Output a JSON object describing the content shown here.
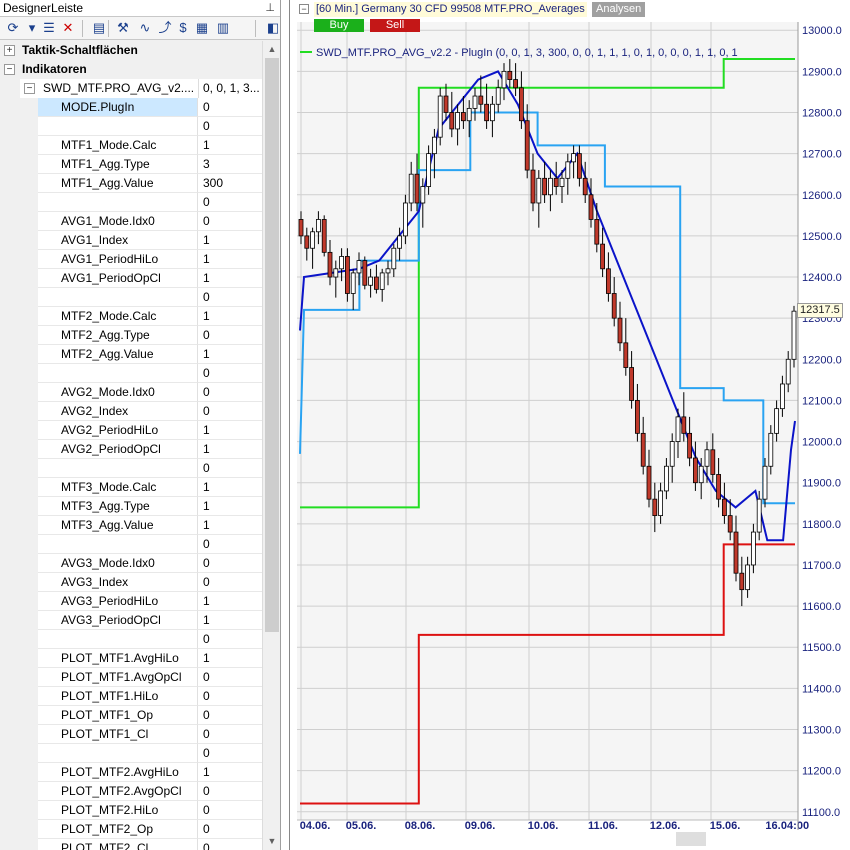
{
  "designer": {
    "title": "DesignerLeiste",
    "pin_glyph": "⊥",
    "toolbar": [
      {
        "icon": "refresh-icon",
        "glyph": "⟳"
      },
      {
        "icon": "dropdown-arrow-icon",
        "glyph": "▾"
      },
      {
        "icon": "list-icon",
        "glyph": "☰"
      },
      {
        "icon": "delete-icon",
        "glyph": "✕"
      },
      {
        "icon": "properties-icon",
        "glyph": "▤"
      },
      {
        "icon": "tools-icon",
        "glyph": "⚒"
      },
      {
        "icon": "indicator-icon",
        "glyph": "∿"
      },
      {
        "icon": "trend-line-icon",
        "glyph": "⤴"
      },
      {
        "icon": "dollar-icon",
        "glyph": "$"
      },
      {
        "icon": "grid-icon",
        "glyph": "▦"
      },
      {
        "icon": "chart-grid-icon",
        "glyph": "▥"
      },
      {
        "icon": "export-icon",
        "glyph": "◧"
      }
    ],
    "categories": [
      {
        "label": "Taktik-Schaltflächen",
        "expander": "+"
      },
      {
        "label": "Indikatoren",
        "expander": "−"
      }
    ],
    "indicator": {
      "name": "SWD_MTF.PRO_AVG_v2....",
      "value": "0, 0, 1, 3...",
      "expander": "−"
    },
    "properties": [
      {
        "name": "MODE.PlugIn",
        "value": "0"
      },
      {
        "name": "",
        "value": "0"
      },
      {
        "name": "MTF1_Mode.Calc",
        "value": "1"
      },
      {
        "name": "MTF1_Agg.Type",
        "value": "3"
      },
      {
        "name": "MTF1_Agg.Value",
        "value": "300"
      },
      {
        "name": "",
        "value": "0"
      },
      {
        "name": "AVG1_Mode.Idx0",
        "value": "0"
      },
      {
        "name": "AVG1_Index",
        "value": "1"
      },
      {
        "name": "AVG1_PeriodHiLo",
        "value": "1"
      },
      {
        "name": "AVG1_PeriodOpCl",
        "value": "1"
      },
      {
        "name": "",
        "value": "0"
      },
      {
        "name": "MTF2_Mode.Calc",
        "value": "1"
      },
      {
        "name": "MTF2_Agg.Type",
        "value": "0"
      },
      {
        "name": "MTF2_Agg.Value",
        "value": "1"
      },
      {
        "name": "",
        "value": "0"
      },
      {
        "name": "AVG2_Mode.Idx0",
        "value": "0"
      },
      {
        "name": "AVG2_Index",
        "value": "0"
      },
      {
        "name": "AVG2_PeriodHiLo",
        "value": "1"
      },
      {
        "name": "AVG2_PeriodOpCl",
        "value": "1"
      },
      {
        "name": "",
        "value": "0"
      },
      {
        "name": "MTF3_Mode.Calc",
        "value": "1"
      },
      {
        "name": "MTF3_Agg.Type",
        "value": "1"
      },
      {
        "name": "MTF3_Agg.Value",
        "value": "1"
      },
      {
        "name": "",
        "value": "0"
      },
      {
        "name": "AVG3_Mode.Idx0",
        "value": "0"
      },
      {
        "name": "AVG3_Index",
        "value": "0"
      },
      {
        "name": "AVG3_PeriodHiLo",
        "value": "1"
      },
      {
        "name": "AVG3_PeriodOpCl",
        "value": "1"
      },
      {
        "name": "",
        "value": "0"
      },
      {
        "name": "PLOT_MTF1.AvgHiLo",
        "value": "1"
      },
      {
        "name": "PLOT_MTF1.AvgOpCl",
        "value": "0"
      },
      {
        "name": "PLOT_MTF1.HiLo",
        "value": "0"
      },
      {
        "name": "PLOT_MTF1_Op",
        "value": "0"
      },
      {
        "name": "PLOT_MTF1_Cl",
        "value": "0"
      },
      {
        "name": "",
        "value": "0"
      },
      {
        "name": "PLOT_MTF2.AvgHiLo",
        "value": "1"
      },
      {
        "name": "PLOT_MTF2.AvgOpCl",
        "value": "0"
      },
      {
        "name": "PLOT_MTF2.HiLo",
        "value": "0"
      },
      {
        "name": "PLOT_MTF2_Op",
        "value": "0"
      },
      {
        "name": "PLOT_MTF2_Cl",
        "value": "0"
      }
    ],
    "selected_index": 0
  },
  "chart_header": {
    "collapse_glyph": "−",
    "title": "[60 Min.] Germany 30 CFD   99508 MTF.PRO_Averages",
    "analysen_tab": "Analysen",
    "buy_label": "Buy",
    "sell_label": "Sell",
    "legend_text": "SWD_MTF.PRO_AVG_v2.2 - PlugIn  (0, 0, 1, 3, 300, 0, 0, 1, 1, 1, 0, 1, 0, 0, 0, 1, 1, 0, 1",
    "current_price": "12317.5"
  },
  "colors": {
    "candle_up": "#ffffff",
    "candle_down": "#c0392b",
    "wick": "#000000",
    "mtf1_line": "#22dd22",
    "mtf2_line": "#29a3f2",
    "mtf3_line": "#0b14c9",
    "red_line": "#dd1111",
    "axis_text": "#1a237e",
    "grid": "#cfcfcf"
  },
  "chart_data": {
    "type": "line",
    "yticks": [
      13000,
      12900,
      12800,
      12700,
      12600,
      12500,
      12400,
      12300,
      12200,
      12100,
      12000,
      11900,
      11800,
      11700,
      11600,
      11500,
      11400,
      11300,
      11200,
      11100
    ],
    "xticks": [
      "04.06.",
      "05.06.",
      "08.06.",
      "09.06.",
      "10.06.",
      "11.06.",
      "12.06.",
      "15.06.",
      "16.",
      "04:00"
    ],
    "ylim": [
      11080,
      13020
    ],
    "candles": [
      [
        0,
        12540,
        12560,
        12480,
        12500
      ],
      [
        1,
        12500,
        12520,
        12440,
        12470
      ],
      [
        2,
        12470,
        12520,
        12420,
        12510
      ],
      [
        3,
        12510,
        12560,
        12480,
        12540
      ],
      [
        4,
        12540,
        12550,
        12450,
        12460
      ],
      [
        5,
        12460,
        12490,
        12380,
        12400
      ],
      [
        6,
        12400,
        12440,
        12350,
        12420
      ],
      [
        7,
        12420,
        12470,
        12390,
        12450
      ],
      [
        8,
        12450,
        12470,
        12340,
        12360
      ],
      [
        9,
        12360,
        12420,
        12320,
        12410
      ],
      [
        10,
        12410,
        12460,
        12380,
        12440
      ],
      [
        11,
        12440,
        12450,
        12370,
        12380
      ],
      [
        12,
        12380,
        12420,
        12350,
        12400
      ],
      [
        13,
        12400,
        12430,
        12360,
        12370
      ],
      [
        14,
        12370,
        12420,
        12340,
        12410
      ],
      [
        15,
        12410,
        12440,
        12380,
        12420
      ],
      [
        16,
        12420,
        12480,
        12400,
        12470
      ],
      [
        17,
        12470,
        12520,
        12440,
        12500
      ],
      [
        18,
        12500,
        12600,
        12480,
        12580
      ],
      [
        19,
        12580,
        12680,
        12560,
        12650
      ],
      [
        20,
        12650,
        12700,
        12560,
        12580
      ],
      [
        21,
        12580,
        12640,
        12520,
        12620
      ],
      [
        22,
        12620,
        12720,
        12600,
        12700
      ],
      [
        23,
        12700,
        12760,
        12640,
        12740
      ],
      [
        24,
        12740,
        12860,
        12720,
        12840
      ],
      [
        25,
        12840,
        12870,
        12780,
        12800
      ],
      [
        26,
        12800,
        12850,
        12740,
        12760
      ],
      [
        27,
        12760,
        12820,
        12720,
        12800
      ],
      [
        28,
        12800,
        12840,
        12760,
        12780
      ],
      [
        29,
        12780,
        12830,
        12740,
        12810
      ],
      [
        30,
        12810,
        12860,
        12780,
        12840
      ],
      [
        31,
        12840,
        12890,
        12800,
        12820
      ],
      [
        32,
        12820,
        12870,
        12760,
        12780
      ],
      [
        33,
        12780,
        12840,
        12740,
        12820
      ],
      [
        34,
        12820,
        12880,
        12800,
        12860
      ],
      [
        35,
        12860,
        12920,
        12830,
        12900
      ],
      [
        36,
        12900,
        12930,
        12860,
        12880
      ],
      [
        37,
        12880,
        12920,
        12840,
        12860
      ],
      [
        38,
        12860,
        12900,
        12760,
        12780
      ],
      [
        39,
        12780,
        12820,
        12640,
        12660
      ],
      [
        40,
        12660,
        12700,
        12560,
        12580
      ],
      [
        41,
        12580,
        12660,
        12520,
        12640
      ],
      [
        42,
        12640,
        12680,
        12580,
        12600
      ],
      [
        43,
        12600,
        12660,
        12560,
        12640
      ],
      [
        44,
        12640,
        12680,
        12600,
        12620
      ],
      [
        45,
        12620,
        12660,
        12580,
        12640
      ],
      [
        46,
        12640,
        12700,
        12600,
        12680
      ],
      [
        47,
        12680,
        12720,
        12640,
        12700
      ],
      [
        48,
        12700,
        12720,
        12620,
        12640
      ],
      [
        49,
        12640,
        12680,
        12580,
        12600
      ],
      [
        50,
        12600,
        12640,
        12520,
        12540
      ],
      [
        51,
        12540,
        12580,
        12460,
        12480
      ],
      [
        52,
        12480,
        12520,
        12400,
        12420
      ],
      [
        53,
        12420,
        12460,
        12340,
        12360
      ],
      [
        54,
        12360,
        12400,
        12280,
        12300
      ],
      [
        55,
        12300,
        12340,
        12220,
        12240
      ],
      [
        56,
        12240,
        12300,
        12160,
        12180
      ],
      [
        57,
        12180,
        12220,
        12080,
        12100
      ],
      [
        58,
        12100,
        12140,
        12000,
        12020
      ],
      [
        59,
        12020,
        12060,
        11920,
        11940
      ],
      [
        60,
        11940,
        11980,
        11840,
        11860
      ],
      [
        61,
        11860,
        11900,
        11780,
        11820
      ],
      [
        62,
        11820,
        11900,
        11800,
        11880
      ],
      [
        63,
        11880,
        11960,
        11860,
        11940
      ],
      [
        64,
        11940,
        12020,
        11900,
        12000
      ],
      [
        65,
        12000,
        12080,
        11960,
        12060
      ],
      [
        66,
        12060,
        12120,
        12000,
        12020
      ],
      [
        67,
        12020,
        12060,
        11940,
        11960
      ],
      [
        68,
        11960,
        12000,
        11880,
        11900
      ],
      [
        69,
        11900,
        11960,
        11860,
        11940
      ],
      [
        70,
        11940,
        12000,
        11900,
        11980
      ],
      [
        71,
        11980,
        12020,
        11900,
        11920
      ],
      [
        72,
        11920,
        11960,
        11840,
        11860
      ],
      [
        73,
        11860,
        11900,
        11800,
        11820
      ],
      [
        74,
        11820,
        11860,
        11760,
        11780
      ],
      [
        75,
        11780,
        11820,
        11660,
        11680
      ],
      [
        76,
        11680,
        11720,
        11600,
        11640
      ],
      [
        77,
        11640,
        11720,
        11620,
        11700
      ],
      [
        78,
        11700,
        11800,
        11680,
        11780
      ],
      [
        79,
        11780,
        11880,
        11760,
        11860
      ],
      [
        80,
        11860,
        11960,
        11840,
        11940
      ],
      [
        81,
        11940,
        12040,
        11920,
        12020
      ],
      [
        82,
        12020,
        12100,
        12000,
        12080
      ],
      [
        83,
        12080,
        12160,
        12060,
        12140
      ],
      [
        84,
        12140,
        12220,
        12120,
        12200
      ],
      [
        85,
        12200,
        12330,
        12180,
        12317
      ]
    ],
    "mtf1_line": [
      [
        0,
        11840
      ],
      [
        30,
        11840
      ],
      [
        30,
        12860
      ],
      [
        107,
        12860
      ],
      [
        107,
        12930
      ],
      [
        125,
        12930
      ]
    ],
    "mtf2_line": [
      [
        0,
        11970
      ],
      [
        1,
        12320
      ],
      [
        15,
        12320
      ],
      [
        15,
        12440
      ],
      [
        30,
        12440
      ],
      [
        30,
        12660
      ],
      [
        43,
        12660
      ],
      [
        43,
        12800
      ],
      [
        60,
        12800
      ],
      [
        60,
        12720
      ],
      [
        77,
        12720
      ],
      [
        77,
        12620
      ],
      [
        96,
        12620
      ],
      [
        96,
        12130
      ],
      [
        107,
        12130
      ],
      [
        107,
        12100
      ],
      [
        117,
        12100
      ],
      [
        117,
        11850
      ],
      [
        125,
        11850
      ]
    ],
    "mtf3_line": [
      [
        0,
        12270
      ],
      [
        1,
        12400
      ],
      [
        15,
        12420
      ],
      [
        20,
        12440
      ],
      [
        25,
        12500
      ],
      [
        30,
        12560
      ],
      [
        35,
        12760
      ],
      [
        45,
        12880
      ],
      [
        50,
        12900
      ],
      [
        55,
        12820
      ],
      [
        60,
        12700
      ],
      [
        65,
        12640
      ],
      [
        70,
        12700
      ],
      [
        75,
        12560
      ],
      [
        80,
        12440
      ],
      [
        85,
        12320
      ],
      [
        90,
        12200
      ],
      [
        95,
        12080
      ],
      [
        100,
        11960
      ],
      [
        105,
        11880
      ],
      [
        110,
        11840
      ],
      [
        115,
        11880
      ],
      [
        118,
        11760
      ],
      [
        122,
        11760
      ],
      [
        124,
        11980
      ],
      [
        125,
        12050
      ]
    ],
    "red_line": [
      [
        0,
        11120
      ],
      [
        30,
        11120
      ],
      [
        30,
        11530
      ],
      [
        107,
        11530
      ],
      [
        107,
        11750
      ],
      [
        125,
        11750
      ]
    ]
  }
}
